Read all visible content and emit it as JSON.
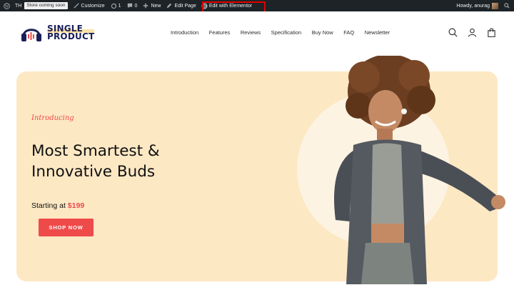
{
  "admin_bar": {
    "site_short": "TH",
    "coming_soon": "Store coming soon",
    "customize": "Customize",
    "updates_count": "1",
    "comments_count": "0",
    "new": "New",
    "edit_page": "Edit Page",
    "edit_elementor": "Edit with Elementor",
    "howdy": "Howdy, anurag"
  },
  "logo": {
    "line1": "SINGLE",
    "line2": "PRODUCT"
  },
  "nav": [
    "Introduction",
    "Features",
    "Reviews",
    "Specification",
    "Buy Now",
    "FAQ",
    "Newsletter"
  ],
  "hero": {
    "intro": "Introducing",
    "headline_line1": "Most Smartest &",
    "headline_line2": "Innovative Buds",
    "starting_text": "Starting at",
    "price": "$199",
    "cta": "SHOP NOW"
  },
  "colors": {
    "accent": "#ef4a4a",
    "hero_bg": "#fde8c4",
    "admin_bar": "#1d2327",
    "brand_navy": "#1a1f5a"
  },
  "icons": [
    "wordpress-icon",
    "customize-icon",
    "updates-icon",
    "comments-icon",
    "plus-icon",
    "edit-icon",
    "elementor-icon",
    "search-icon",
    "user-icon",
    "bag-icon"
  ]
}
